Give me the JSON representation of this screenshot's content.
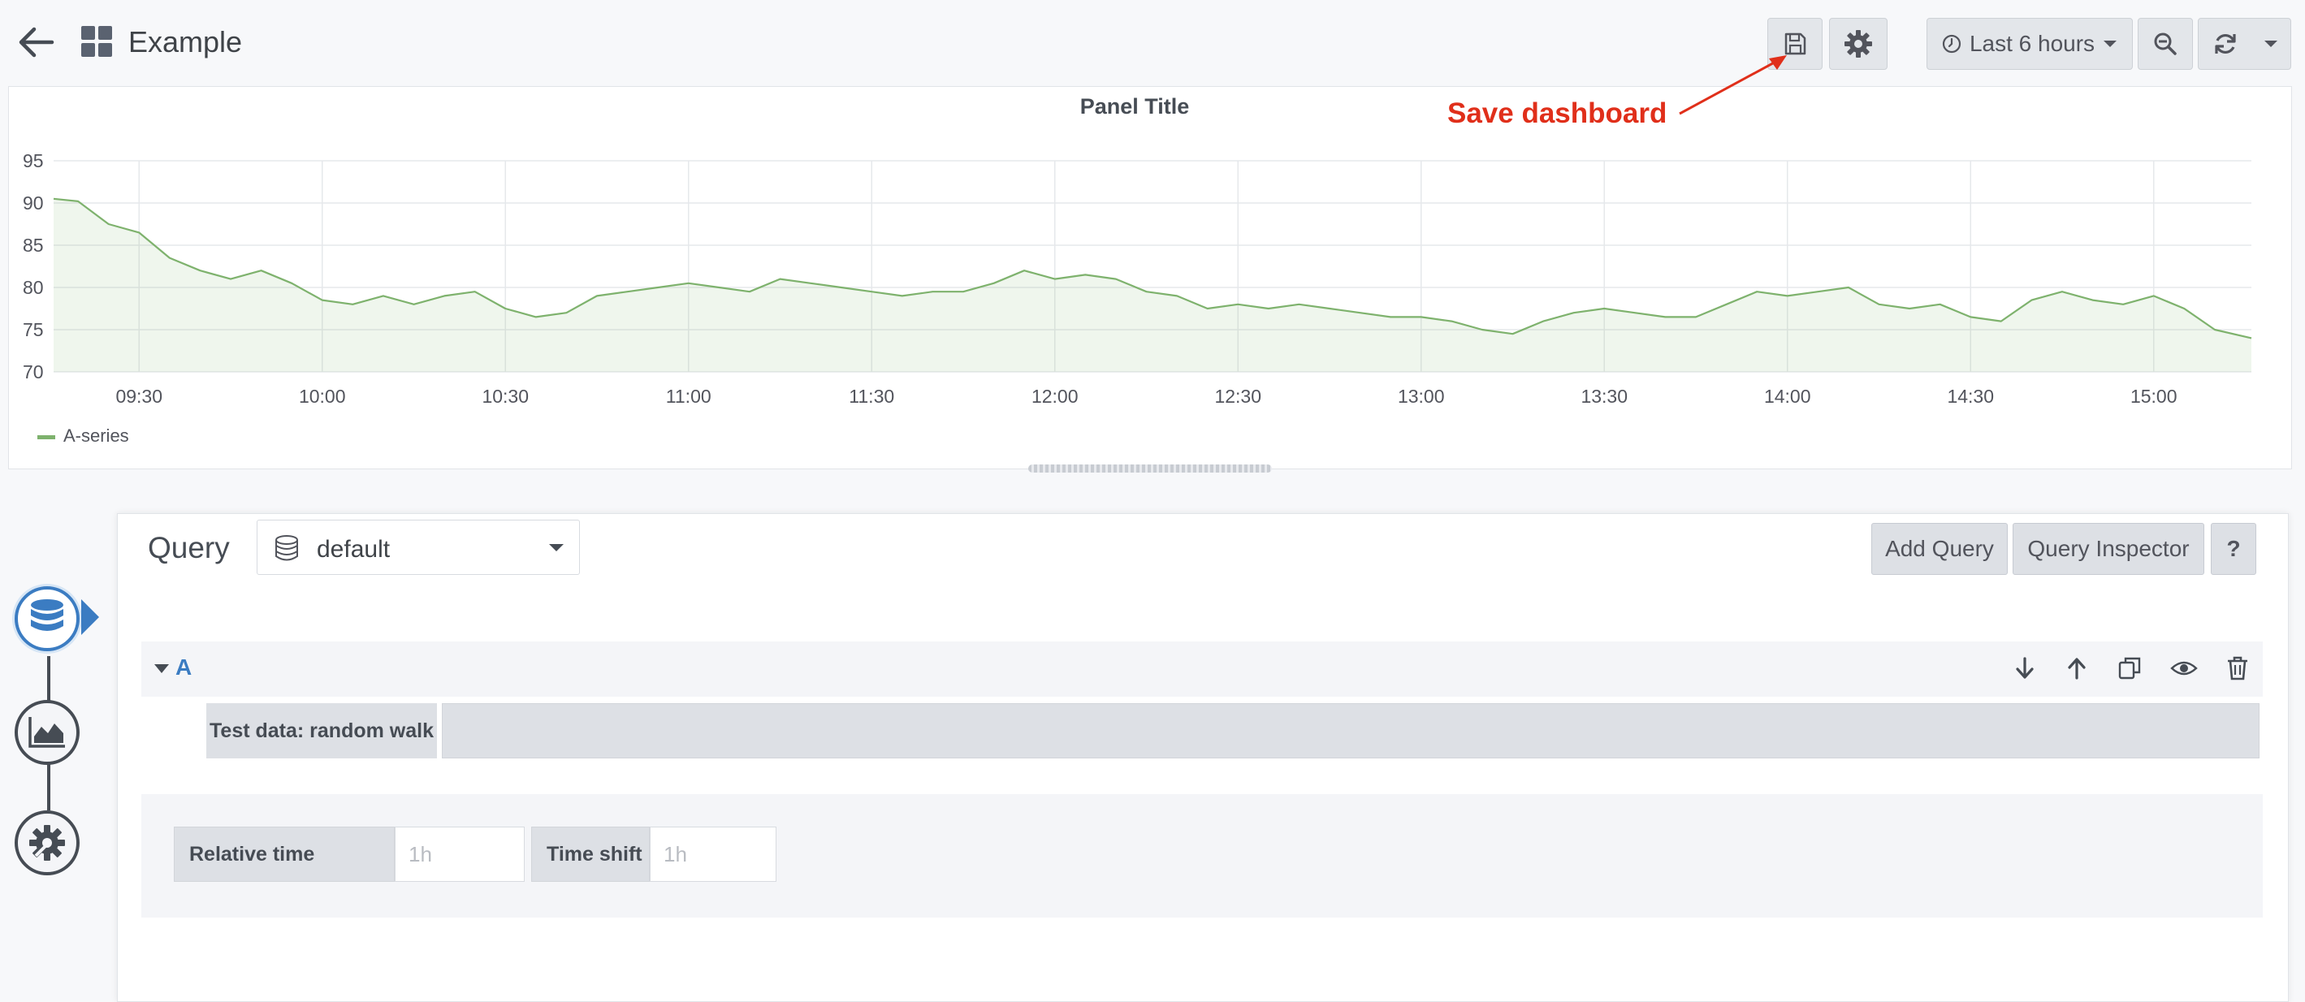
{
  "nav": {
    "title": "Example",
    "time_range": "Last 6 hours",
    "icons": [
      "arrow-left-icon",
      "dashboard-grid-icon",
      "save-icon",
      "gear-icon",
      "clock-icon",
      "zoom-out-icon",
      "refresh-icon",
      "caret-down-icon"
    ]
  },
  "annotation": {
    "text": "Save dashboard",
    "color": "#e02f1a"
  },
  "chart_data": {
    "type": "area",
    "title": "Panel Title",
    "xlabel": "",
    "ylabel": "",
    "x_ticks": [
      "09:30",
      "10:00",
      "10:30",
      "11:00",
      "11:30",
      "12:00",
      "12:30",
      "13:00",
      "13:30",
      "14:00",
      "14:30",
      "15:00"
    ],
    "x_range": [
      "09:16",
      "15:16"
    ],
    "y_ticks": [
      70,
      75,
      80,
      85,
      90,
      95
    ],
    "ylim": [
      70,
      95
    ],
    "grid": true,
    "legend_position": "bottom-left",
    "series": [
      {
        "name": "A-series",
        "color": "#7eb26d",
        "x": [
          "09:16",
          "09:20",
          "09:25",
          "09:30",
          "09:35",
          "09:40",
          "09:45",
          "09:50",
          "09:55",
          "10:00",
          "10:05",
          "10:10",
          "10:15",
          "10:20",
          "10:25",
          "10:30",
          "10:35",
          "10:40",
          "10:45",
          "10:50",
          "10:55",
          "11:00",
          "11:05",
          "11:10",
          "11:15",
          "11:20",
          "11:25",
          "11:30",
          "11:35",
          "11:40",
          "11:45",
          "11:50",
          "11:55",
          "12:00",
          "12:05",
          "12:10",
          "12:15",
          "12:20",
          "12:25",
          "12:30",
          "12:35",
          "12:40",
          "12:45",
          "12:50",
          "12:55",
          "13:00",
          "13:05",
          "13:10",
          "13:15",
          "13:20",
          "13:25",
          "13:30",
          "13:35",
          "13:40",
          "13:45",
          "13:50",
          "13:55",
          "14:00",
          "14:05",
          "14:10",
          "14:15",
          "14:20",
          "14:25",
          "14:30",
          "14:35",
          "14:40",
          "14:45",
          "14:50",
          "14:55",
          "15:00",
          "15:05",
          "15:10",
          "15:16"
        ],
        "values": [
          90.5,
          90.2,
          87.5,
          86.5,
          83.5,
          82.0,
          81.0,
          82.0,
          80.5,
          78.5,
          78.0,
          79.0,
          78.0,
          79.0,
          79.5,
          77.5,
          76.5,
          77.0,
          79.0,
          79.5,
          80.0,
          80.5,
          80.0,
          79.5,
          81.0,
          80.5,
          80.0,
          79.5,
          79.0,
          79.5,
          79.5,
          80.5,
          82.0,
          81.0,
          81.5,
          81.0,
          79.5,
          79.0,
          77.5,
          78.0,
          77.5,
          78.0,
          77.5,
          77.0,
          76.5,
          76.5,
          76.0,
          75.0,
          74.5,
          76.0,
          77.0,
          77.5,
          77.0,
          76.5,
          76.5,
          78.0,
          79.5,
          79.0,
          79.5,
          80.0,
          78.0,
          77.5,
          78.0,
          76.5,
          76.0,
          78.5,
          79.5,
          78.5,
          78.0,
          79.0,
          77.5,
          75.0,
          74.0
        ]
      }
    ]
  },
  "editor": {
    "query_label": "Query",
    "datasource": "default",
    "add_query": "Add Query",
    "query_inspector": "Query Inspector",
    "help": "?",
    "query_letter": "A",
    "scenario_label": "Test data: random walk",
    "row_icons": [
      "arrow-down-icon",
      "arrow-up-icon",
      "duplicate-icon",
      "eye-icon",
      "trash-icon"
    ],
    "relative_time_label": "Relative time",
    "relative_time_placeholder": "1h",
    "time_shift_label": "Time shift",
    "time_shift_placeholder": "1h"
  },
  "wizard": {
    "steps": [
      "queries",
      "visualization",
      "general"
    ],
    "active": "queries",
    "icons": [
      "database-icon",
      "chart-icon",
      "cogs-icon"
    ]
  }
}
